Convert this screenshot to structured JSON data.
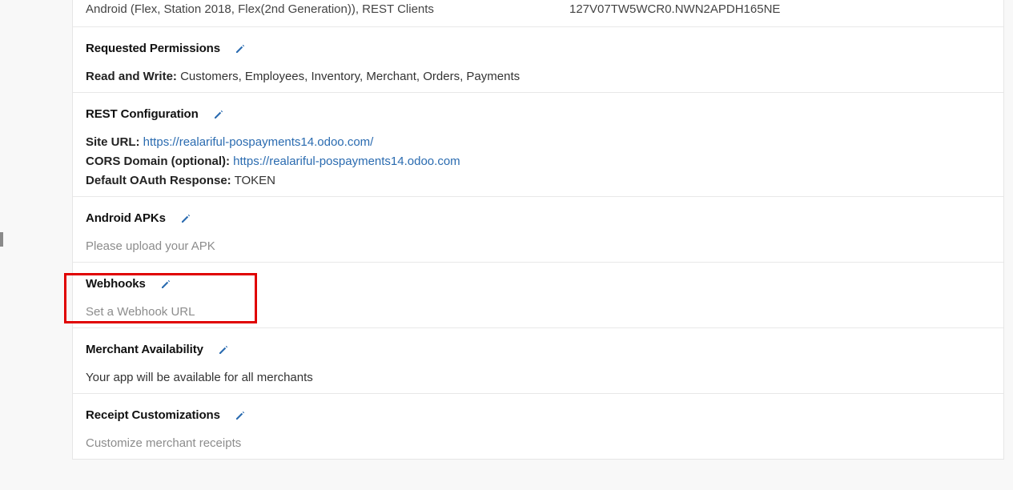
{
  "top_row": {
    "devices": "Android (Flex, Station 2018, Flex(2nd Generation)), REST Clients",
    "app_id": "127V07TW5WCR0.NWN2APDH165NE"
  },
  "sections": {
    "permissions": {
      "title": "Requested Permissions",
      "label": "Read and Write:",
      "value": "Customers, Employees, Inventory, Merchant, Orders, Payments"
    },
    "rest": {
      "title": "REST Configuration",
      "site_url_label": "Site URL:",
      "site_url": "https://realariful-pospayments14.odoo.com/",
      "cors_label": "CORS Domain (optional):",
      "cors": "https://realariful-pospayments14.odoo.com",
      "oauth_label": "Default OAuth Response:",
      "oauth": "TOKEN"
    },
    "apks": {
      "title": "Android APKs",
      "placeholder": "Please upload your APK"
    },
    "webhooks": {
      "title": "Webhooks",
      "placeholder": "Set a Webhook URL"
    },
    "availability": {
      "title": "Merchant Availability",
      "text": "Your app will be available for all merchants"
    },
    "receipt": {
      "title": "Receipt Customizations",
      "placeholder": "Customize merchant receipts"
    }
  },
  "colors": {
    "link": "#2a6bb0",
    "edit_icon": "#2a6bb0",
    "highlight": "#e00000"
  },
  "icons": {
    "edit": "pencil-icon"
  }
}
